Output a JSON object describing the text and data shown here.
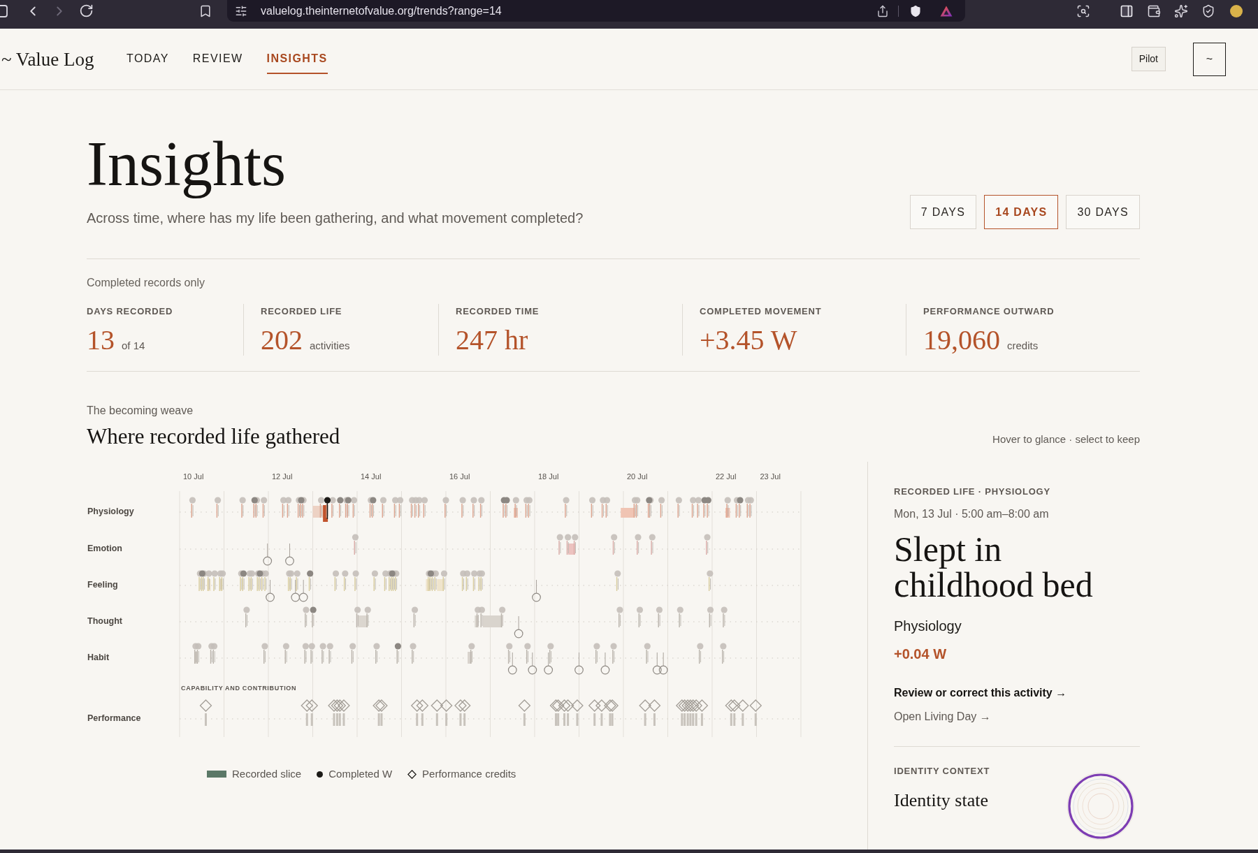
{
  "browser": {
    "url": "valuelog.theinternetofvalue.org/trends?range=14"
  },
  "header": {
    "logo": "~ Value Log",
    "tabs": [
      {
        "label": "TODAY",
        "selected": false
      },
      {
        "label": "REVIEW",
        "selected": false
      },
      {
        "label": "INSIGHTS",
        "selected": true
      }
    ],
    "pilot_button": "Pilot",
    "menu_button": "~"
  },
  "page": {
    "title": "Insights",
    "subtitle": "Across time, where has my life been gathering, and what movement completed?",
    "range_options": [
      {
        "label": "7 DAYS",
        "selected": false
      },
      {
        "label": "14 DAYS",
        "selected": true
      },
      {
        "label": "30 DAYS",
        "selected": false
      }
    ],
    "stats_caption": "Completed records only",
    "stats": [
      {
        "label": "DAYS RECORDED",
        "value": "13",
        "unit": "of 14"
      },
      {
        "label": "RECORDED LIFE",
        "value": "202",
        "unit": "activities"
      },
      {
        "label": "RECORDED TIME",
        "value": "247 hr"
      },
      {
        "label": "COMPLETED MOVEMENT",
        "value": "+3.45 W"
      },
      {
        "label": "PERFORMANCE OUTWARD",
        "value": "19,060",
        "unit": "credits"
      }
    ]
  },
  "weave": {
    "eyebrow": "The becoming weave",
    "title": "Where recorded life gathered",
    "hint": "Hover to glance · select to keep",
    "date_labels": [
      "10 Jul",
      "12 Jul",
      "14 Jul",
      "16 Jul",
      "18 Jul",
      "20 Jul",
      "22 Jul",
      "23 Jul"
    ],
    "rows": [
      "Physiology",
      "Emotion",
      "Feeling",
      "Thought",
      "Habit"
    ],
    "section_label": "CAPABILITY AND CONTRIBUTION",
    "performance_row": "Performance",
    "legend": [
      {
        "kind": "slice",
        "label": "Recorded slice"
      },
      {
        "kind": "dot",
        "label": "Completed W"
      },
      {
        "kind": "diamond",
        "label": "Performance credits"
      }
    ]
  },
  "detail": {
    "eyebrow": "RECORDED LIFE · PHYSIOLOGY",
    "when": "Mon, 13 Jul · 5:00 am–8:00 am",
    "title": "Slept in childhood bed",
    "category": "Physiology",
    "movement": "+0.04 W",
    "links": [
      {
        "kind": "primary",
        "label": "Review or correct this activity →"
      },
      {
        "kind": "secondary",
        "label": "Open Living Day →"
      }
    ],
    "identity": {
      "eyebrow": "IDENTITY CONTEXT",
      "title": "Identity state"
    }
  }
}
